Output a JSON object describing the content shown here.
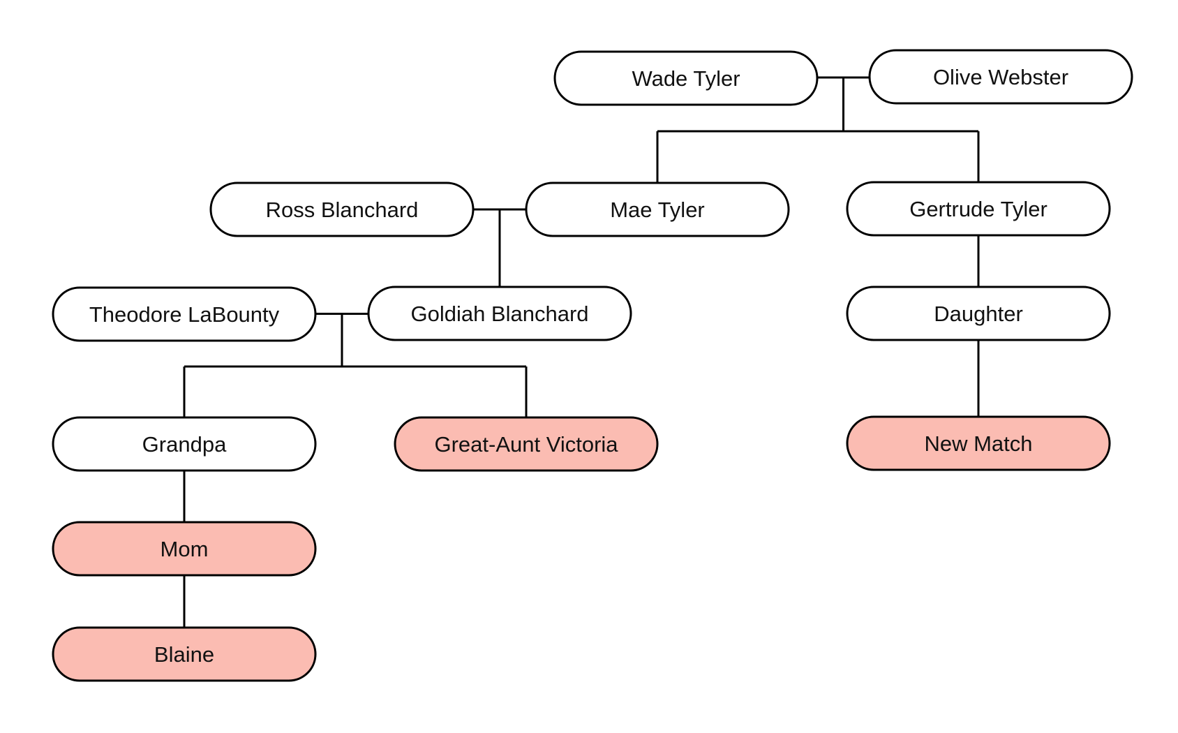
{
  "diagram": {
    "type": "family-tree",
    "highlight_color": "#fbbcb2",
    "default_fill": "#ffffff",
    "stroke_color": "#000000",
    "nodes": [
      {
        "id": "wade",
        "label": "Wade Tyler",
        "highlighted": false
      },
      {
        "id": "olive",
        "label": "Olive Webster",
        "highlighted": false
      },
      {
        "id": "ross",
        "label": "Ross Blanchard",
        "highlighted": false
      },
      {
        "id": "mae",
        "label": "Mae Tyler",
        "highlighted": false
      },
      {
        "id": "gertrude",
        "label": "Gertrude Tyler",
        "highlighted": false
      },
      {
        "id": "theodore",
        "label": "Theodore LaBounty",
        "highlighted": false
      },
      {
        "id": "goldiah",
        "label": "Goldiah Blanchard",
        "highlighted": false
      },
      {
        "id": "daughter",
        "label": "Daughter",
        "highlighted": false
      },
      {
        "id": "grandpa",
        "label": "Grandpa",
        "highlighted": false
      },
      {
        "id": "victoria",
        "label": "Great-Aunt Victoria",
        "highlighted": true
      },
      {
        "id": "newmatch",
        "label": "New Match",
        "highlighted": true
      },
      {
        "id": "mom",
        "label": "Mom",
        "highlighted": true
      },
      {
        "id": "blaine",
        "label": "Blaine",
        "highlighted": true
      }
    ],
    "couples": [
      {
        "a": "wade",
        "b": "olive",
        "children": [
          "mae",
          "gertrude"
        ]
      },
      {
        "a": "ross",
        "b": "mae",
        "children": [
          "goldiah"
        ]
      },
      {
        "a": "theodore",
        "b": "goldiah",
        "children": [
          "grandpa",
          "victoria"
        ]
      }
    ],
    "parent_child": [
      {
        "parent": "gertrude",
        "child": "daughter"
      },
      {
        "parent": "daughter",
        "child": "newmatch"
      },
      {
        "parent": "grandpa",
        "child": "mom"
      },
      {
        "parent": "mom",
        "child": "blaine"
      }
    ]
  }
}
